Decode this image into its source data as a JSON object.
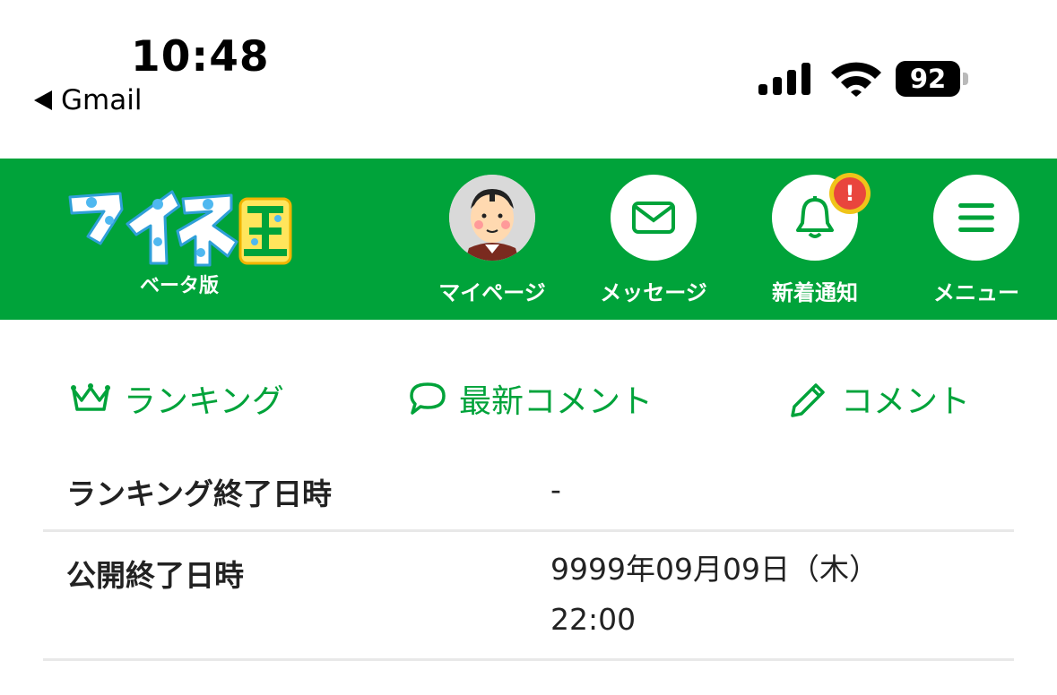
{
  "status_bar": {
    "time": "10:48",
    "back_app": "Gmail",
    "battery": "92"
  },
  "header": {
    "logo_text": "マイネ王",
    "logo_sub": "ベータ版",
    "nav": [
      {
        "label": "マイページ",
        "icon": "avatar"
      },
      {
        "label": "メッセージ",
        "icon": "envelope-icon"
      },
      {
        "label": "新着通知",
        "icon": "bell-icon",
        "badge": "!"
      },
      {
        "label": "メニュー",
        "icon": "hamburger-icon"
      }
    ]
  },
  "tabs": [
    {
      "label": "ランキング",
      "icon": "crown-icon"
    },
    {
      "label": "最新コメント",
      "icon": "speech-bubble-icon"
    },
    {
      "label": "コメント",
      "icon": "pencil-icon"
    }
  ],
  "info": {
    "rows": [
      {
        "label": "ランキング終了日時",
        "value": "-"
      },
      {
        "label": "公開終了日時",
        "value_line1": "9999年09月09日（木）",
        "value_line2": "22:00"
      }
    ]
  },
  "colors": {
    "brand_green": "#00a33a",
    "badge_yellow": "#f0c419",
    "badge_red": "#e9453d",
    "logo_blue": "#4fb8f0",
    "logo_yellow": "#ffe55c"
  }
}
